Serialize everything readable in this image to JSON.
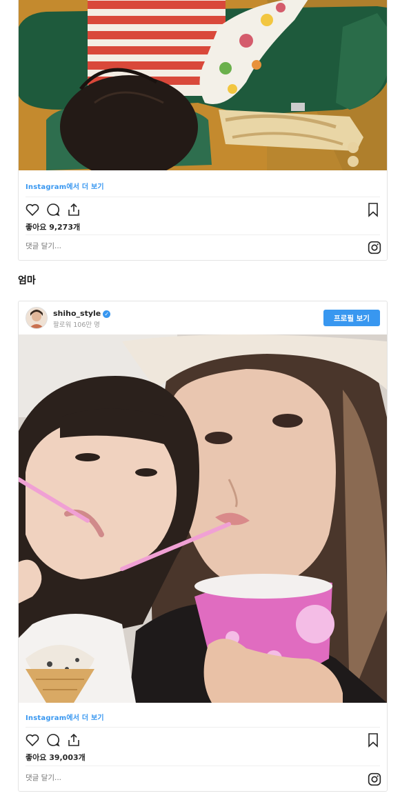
{
  "post1": {
    "view_link": "Instagram에서 더 보기",
    "likes": "좋아요 9,273개",
    "comment_placeholder": "댓글 달기..."
  },
  "heading": "엄마",
  "post2": {
    "username": "shiho_style",
    "followers": "팔로워 106만 명",
    "profile_button": "프로필 보기",
    "view_link": "Instagram에서 더 보기",
    "likes": "좋아요 39,003개",
    "comment_placeholder": "댓글 달기..."
  },
  "icons": {
    "like": "heart-icon",
    "comment": "comment-icon",
    "share": "share-icon",
    "save": "bookmark-icon",
    "instagram": "instagram-icon",
    "verified": "verified-badge-icon"
  },
  "colors": {
    "link": "#3897f0",
    "button": "#3897f0"
  }
}
